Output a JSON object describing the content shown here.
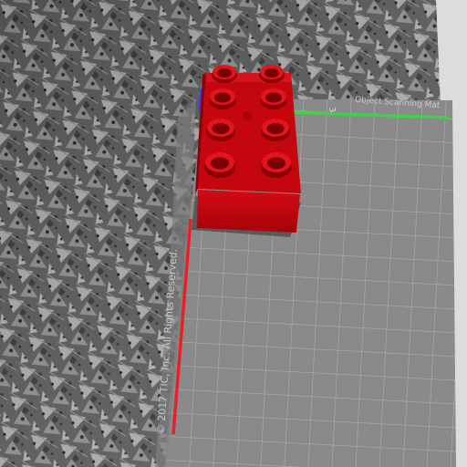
{
  "mat": {
    "copyright": "© 2017 TIC, Inc. All Rights Reserved.",
    "label": "Object Scanning Mat",
    "marker_number": "3",
    "colors": {
      "background_dark": "#5a5a5a",
      "pattern_light": "#cfcfcf",
      "grid_panel": "#8a8a8a",
      "grid_line": "#b8b8b8",
      "border": "#dedede"
    }
  },
  "object": {
    "name": "red-duplo-brick",
    "studs": 8,
    "color": "#c4060f"
  },
  "axes": {
    "x_color": "#3fd14a",
    "y_color": "#e8202a",
    "z_color": "#3a3aff"
  }
}
